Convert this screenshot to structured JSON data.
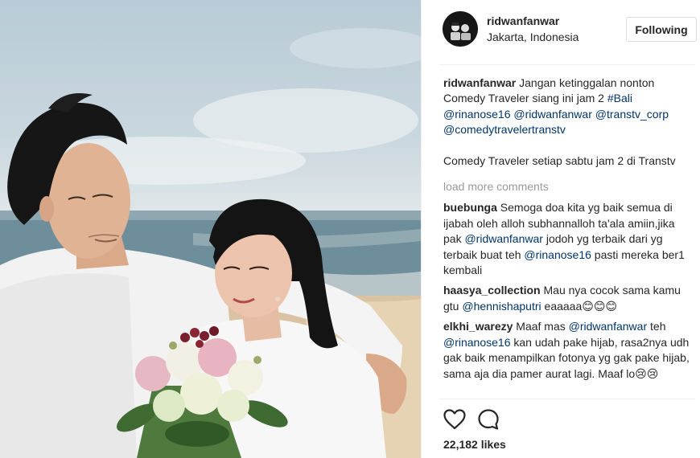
{
  "post": {
    "username": "ridwanfanwar",
    "location": "Jakarta, Indonesia",
    "follow_label": "Following",
    "caption": {
      "username": "ridwanfanwar",
      "text": " Jangan ketinggalan nonton Comedy Traveler siang ini jam 2 ",
      "tags": [
        "#Bali",
        "@rinanose16",
        "@ridwanfanwar",
        "@transtv_corp",
        "@comedytravelertranstv"
      ],
      "text2": "Comedy Traveler setiap sabtu jam 2 di Transtv"
    },
    "load_more": "load more comments",
    "comments": [
      {
        "username": "buebunga",
        "parts": [
          {
            "t": " Semoga doa kita yg baik semua di ijabah oleh alloh subhannalloh ta'ala amiin,jika pak "
          },
          {
            "l": "@ridwanfanwar"
          },
          {
            "t": " jodoh yg terbaik dari yg terbaik buat teh "
          },
          {
            "l": "@rinanose16"
          },
          {
            "t": " pasti mereka ber1 kembali"
          }
        ]
      },
      {
        "username": "haasya_collection",
        "parts": [
          {
            "t": " Mau nya cocok sama kamu gtu "
          },
          {
            "l": "@hennishaputri"
          },
          {
            "t": " eaaaaa😊😊😊"
          }
        ]
      },
      {
        "username": "elkhi_warezy",
        "parts": [
          {
            "t": " Maaf mas "
          },
          {
            "l": "@ridwanfanwar"
          },
          {
            "t": " teh "
          },
          {
            "l": "@rinanose16"
          },
          {
            "t": " kan udah pake hijab, rasa2nya udh gak baik menampilkan fotonya yg gak pake hijab, sama aja dia pamer aurat lagi. Maaf lo😢😢"
          }
        ]
      }
    ],
    "likes": "22,182 likes"
  },
  "icons": {
    "like": "heart-outline-icon",
    "comment": "speech-bubble-icon"
  }
}
